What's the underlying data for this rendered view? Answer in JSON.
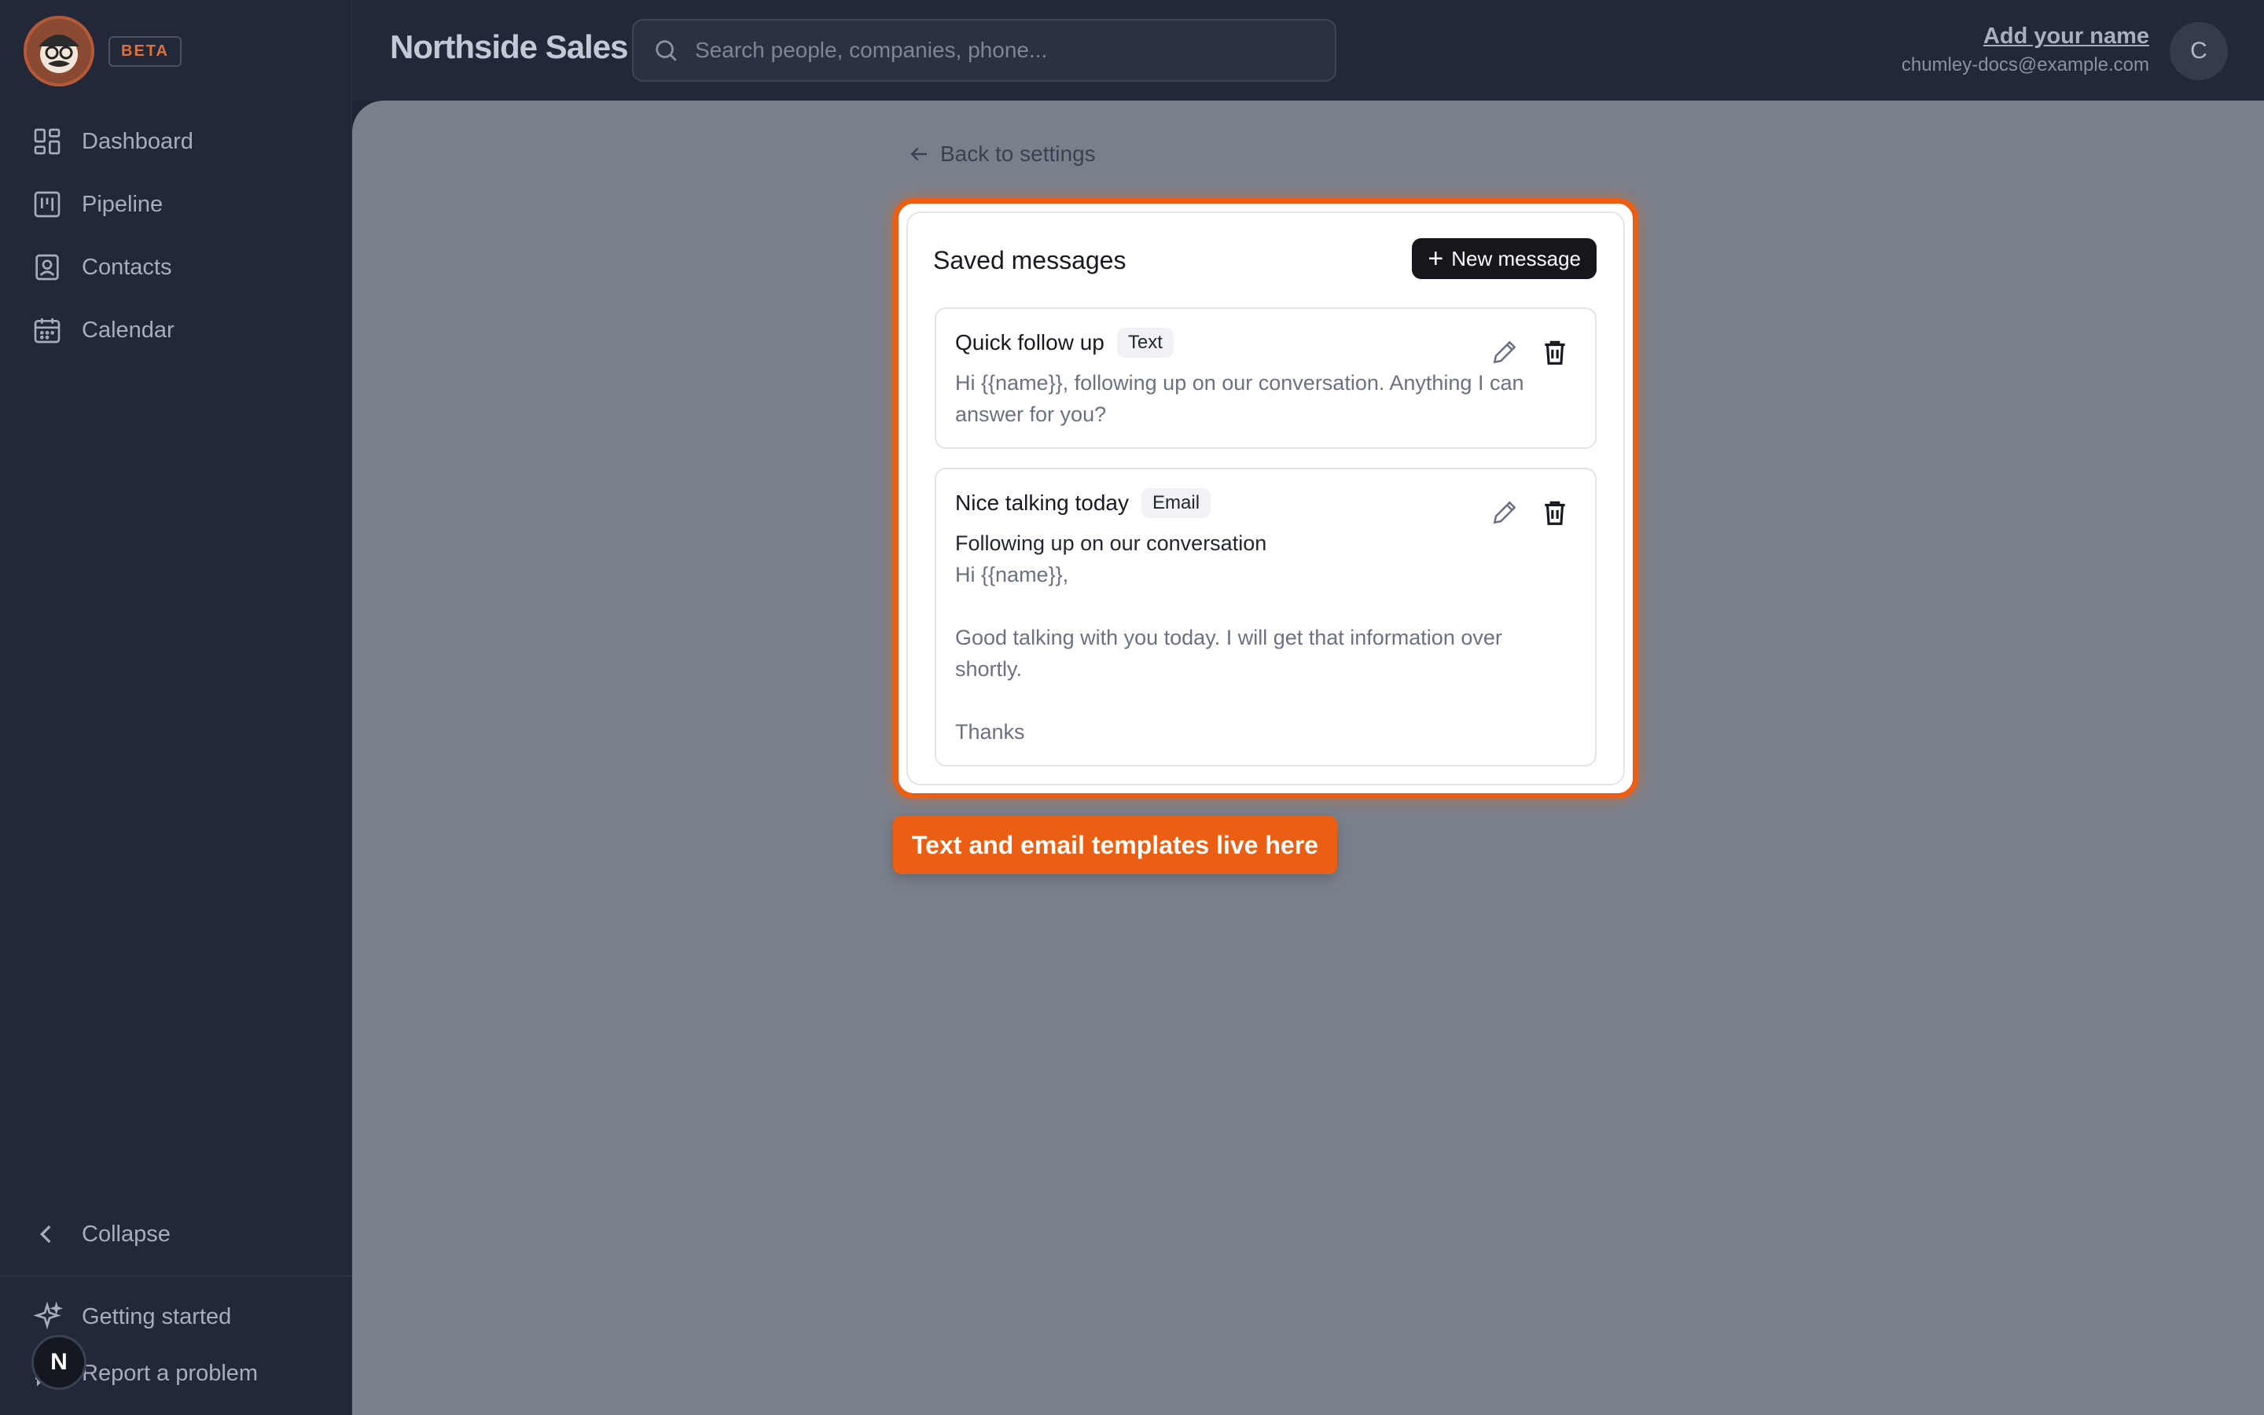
{
  "sidebar": {
    "beta_label": "BETA",
    "items": [
      {
        "label": "Dashboard",
        "icon": "dashboard-icon"
      },
      {
        "label": "Pipeline",
        "icon": "pipeline-icon"
      },
      {
        "label": "Contacts",
        "icon": "contacts-icon"
      },
      {
        "label": "Calendar",
        "icon": "calendar-icon"
      }
    ],
    "collapse_label": "Collapse",
    "getting_started_label": "Getting started",
    "report_label": "Report a problem",
    "n_badge": "N"
  },
  "header": {
    "brand": "Northside Sales",
    "search_placeholder": "Search people, companies, phone...",
    "user_name": "Add your name",
    "user_email": "chumley-docs@example.com",
    "avatar_letter": "C"
  },
  "main": {
    "back_label": "Back to settings",
    "card_title": "Saved messages",
    "new_button_label": "New message",
    "messages": [
      {
        "name": "Quick follow up",
        "type": "Text",
        "body": "Hi {{name}}, following up on our conversation. Anything I can answer for you?"
      },
      {
        "name": "Nice talking today",
        "type": "Email",
        "subject": "Following up on our conversation",
        "body_line1": "Hi {{name}},",
        "body_line2": "Good talking with you today. I will get that information over shortly.",
        "body_line3": "Thanks"
      }
    ],
    "callout": "Text and email templates live here"
  },
  "colors": {
    "accent": "#ea5f14",
    "sidebar_bg": "#222838",
    "main_bg": "#7a808b"
  }
}
